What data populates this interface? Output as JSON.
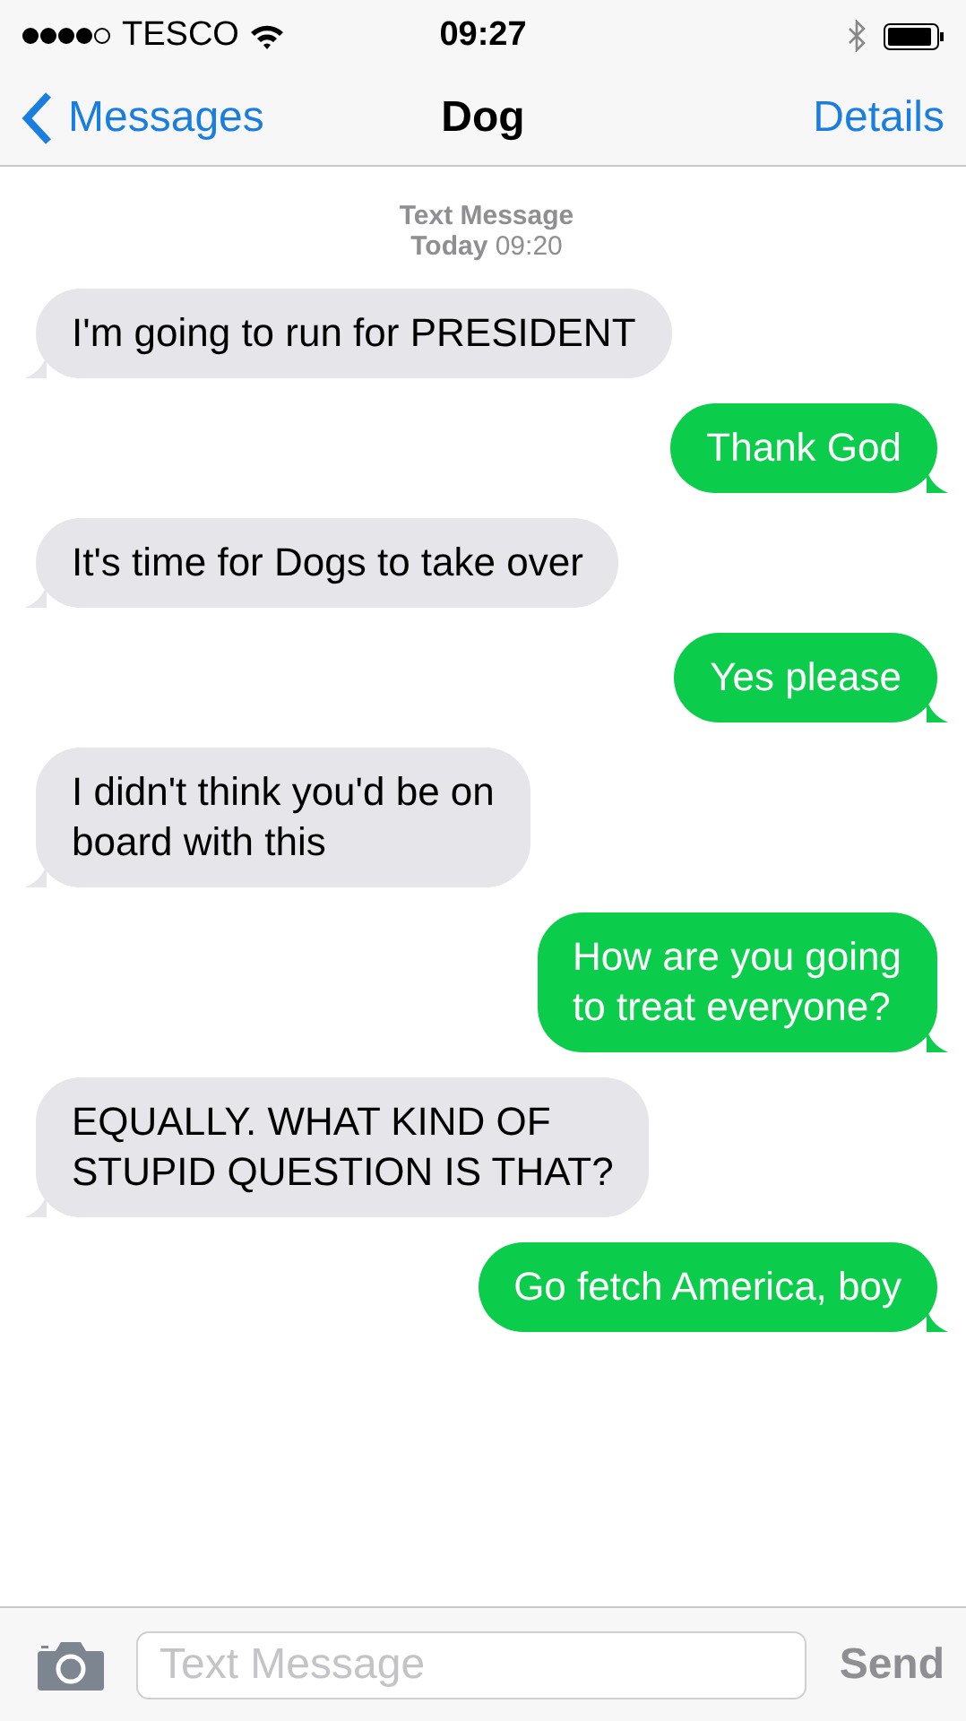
{
  "status_bar": {
    "carrier": "TESCO",
    "time": "09:27"
  },
  "nav": {
    "back": "Messages",
    "title": "Dog",
    "action": "Details"
  },
  "thread_header": {
    "service": "Text Message",
    "timestamp": "**Today** 09:20"
  },
  "messages": [
    {
      "kind": "received",
      "text": "I'm going to run for PRESIDENT"
    },
    {
      "kind": "sent",
      "text": "Thank God"
    },
    {
      "kind": "received",
      "text": "It's time for Dogs to take over"
    },
    {
      "kind": "sent",
      "text": "Yes please"
    },
    {
      "kind": "received",
      "text": "I didn't think you'd be on\nboard with this"
    },
    {
      "kind": "sent",
      "text": "How are you going\nto treat everyone?"
    },
    {
      "kind": "received",
      "text": "EQUALLY. WHAT KIND OF\nSTUPID QUESTION IS THAT?"
    },
    {
      "kind": "sent",
      "text": "Go fetch America, boy"
    }
  ],
  "composer": {
    "placeholder": "Text Message",
    "send": "Send"
  }
}
